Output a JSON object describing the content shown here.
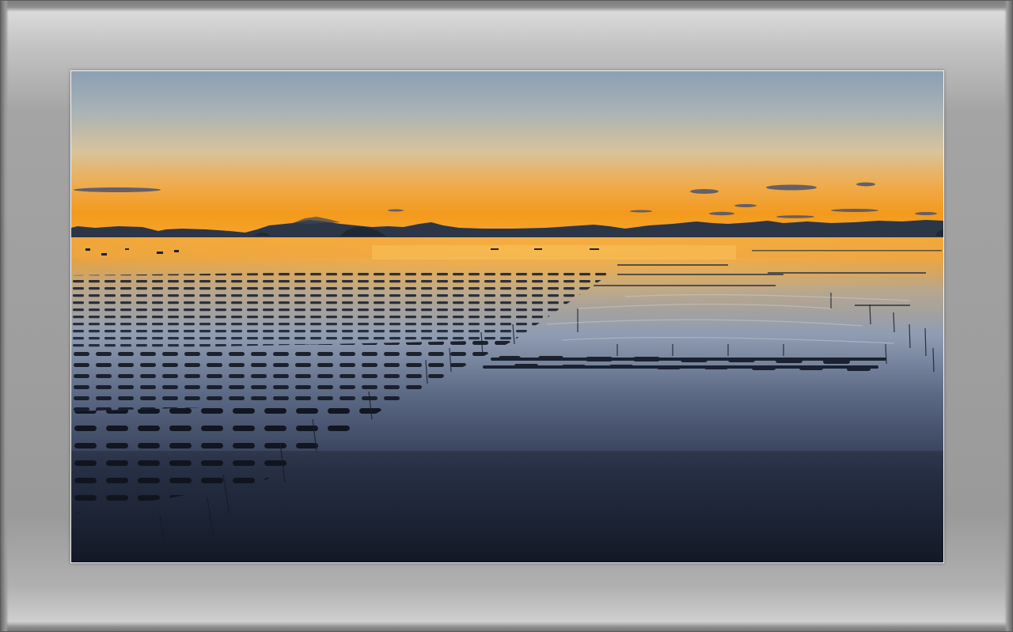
{
  "image": {
    "subject": "sunset-over-seaweed-farm-tidal-flats",
    "colors": {
      "sky_top": "#8aa0b6",
      "sky_mid": "#d8c59a",
      "horizon_orange": "#f39a1c",
      "horizon_glow": "#f7b13a",
      "mountains": "#2a3444",
      "water_reflection": "#e9a73a",
      "water_mid": "#7b8aa4",
      "water_dark": "#1a2030",
      "frame_gray": "#a0a0a0",
      "mat_border": "#f4f4f4"
    }
  }
}
